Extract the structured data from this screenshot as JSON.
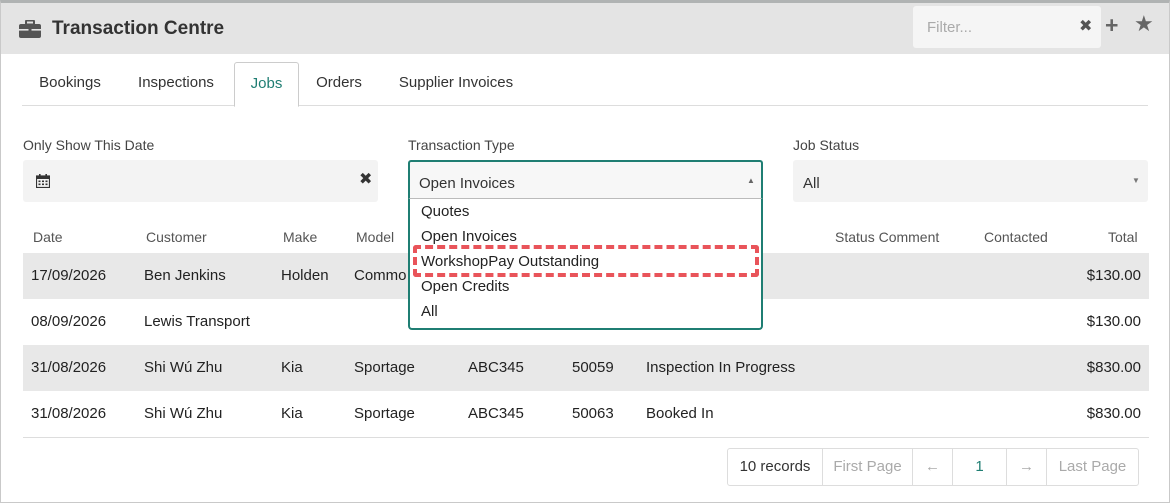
{
  "header": {
    "title": "Transaction Centre",
    "filter_placeholder": "Filter...",
    "clear_icon": "✖",
    "add_icon": "+",
    "star_icon": "★"
  },
  "tabs": [
    {
      "label": "Bookings",
      "active": false
    },
    {
      "label": "Inspections",
      "active": false
    },
    {
      "label": "Jobs",
      "active": true
    },
    {
      "label": "Orders",
      "active": false
    },
    {
      "label": "Supplier Invoices",
      "active": false
    }
  ],
  "filters": {
    "date_label": "Only Show This Date",
    "date_value": "",
    "type_label": "Transaction Type",
    "type_value": "Open Invoices",
    "type_options": [
      "Quotes",
      "Open Invoices",
      "WorkshopPay Outstanding",
      "Open Credits",
      "All"
    ],
    "highlighted_option": "WorkshopPay Outstanding",
    "status_label": "Job Status",
    "status_value": "All"
  },
  "table": {
    "columns": [
      "Date",
      "Customer",
      "Make",
      "Model",
      "Status Comment",
      "Contacted",
      "Total"
    ],
    "rows": [
      {
        "date": "17/09/2026",
        "customer": "Ben Jenkins",
        "make": "Holden",
        "model": "Commo",
        "rego": "",
        "job": "",
        "status": "",
        "total": "$130.00"
      },
      {
        "date": "08/09/2026",
        "customer": "Lewis Transport",
        "make": "",
        "model": "",
        "rego": "",
        "job": "",
        "status": "",
        "total": "$130.00"
      },
      {
        "date": "31/08/2026",
        "customer": "Shi Wú Zhu",
        "make": "Kia",
        "model": "Sportage",
        "rego": "ABC345",
        "job": "50059",
        "status": "Inspection In Progress",
        "total": "$830.00"
      },
      {
        "date": "31/08/2026",
        "customer": "Shi Wú Zhu",
        "make": "Kia",
        "model": "Sportage",
        "rego": "ABC345",
        "job": "50063",
        "status": "Booked In",
        "total": "$830.00"
      }
    ]
  },
  "pagination": {
    "records": "10 records",
    "first": "First Page",
    "prev": "←",
    "current": "1",
    "next": "→",
    "last": "Last Page"
  },
  "colors": {
    "accent": "#1f7e73",
    "highlight": "#e9545a",
    "header_bg": "#e4e4e4",
    "row_shade": "#e8e8e8"
  }
}
